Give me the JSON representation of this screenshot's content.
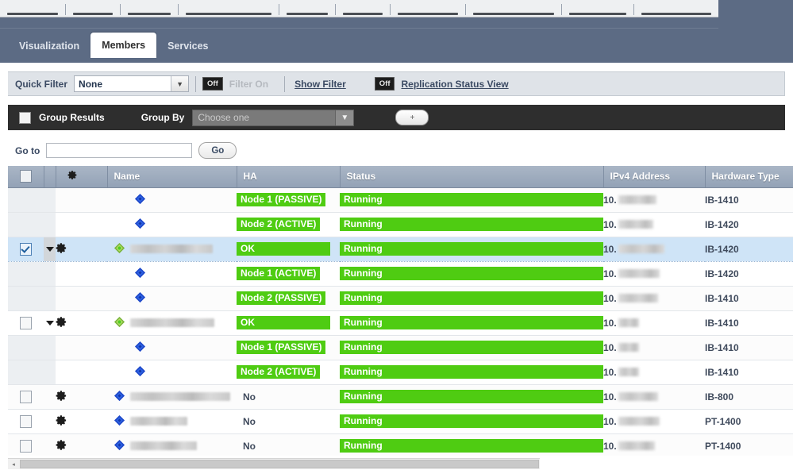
{
  "menu_strip": {
    "item_count": 11,
    "note": "cut-off menu bar"
  },
  "tabs": [
    {
      "label": "Visualization",
      "active": false
    },
    {
      "label": "Members",
      "active": true
    },
    {
      "label": "Services",
      "active": false
    }
  ],
  "quick_filter": {
    "label": "Quick Filter",
    "selected": "None",
    "placeholder": "None",
    "toggle_badge": "Off",
    "toggle_text": "Filter On",
    "show_filter_link": "Show Filter",
    "replication_badge": "Off",
    "replication_link": "Replication Status View",
    "caret_icon": "chevron-down-icon"
  },
  "group_bar": {
    "group_results_label": "Group Results",
    "group_by_label": "Group By",
    "group_by_selected": "Choose one",
    "add_button_label": "+",
    "caret_icon": "chevron-down-icon"
  },
  "goto_bar": {
    "label": "Go to",
    "input_value": "",
    "input_placeholder": "",
    "go_button": "Go"
  },
  "table": {
    "columns": [
      {
        "key": "chk",
        "label": ""
      },
      {
        "key": "exp",
        "label": ""
      },
      {
        "key": "gear",
        "label": "",
        "icon": "gear-icon"
      },
      {
        "key": "name",
        "label": "Name"
      },
      {
        "key": "ha",
        "label": "HA"
      },
      {
        "key": "status",
        "label": "Status"
      },
      {
        "key": "ip",
        "label": "IPv4 Address"
      },
      {
        "key": "hw",
        "label": "Hardware Type"
      }
    ],
    "rows": [
      {
        "kind": "child",
        "checkbox": "none",
        "expand": false,
        "gear": false,
        "name": "",
        "name_redacted": false,
        "name_width": 0,
        "ha": "Node 1 (PASSIVE)",
        "ha_style": "badge",
        "status": "Running",
        "ip_prefix": "10.",
        "ip_width": 48,
        "hw": "IB-1410",
        "selected": false
      },
      {
        "kind": "child",
        "checkbox": "none",
        "expand": false,
        "gear": false,
        "name": "",
        "name_redacted": false,
        "name_width": 0,
        "ha": "Node 2 (ACTIVE)",
        "ha_style": "badge",
        "status": "Running",
        "ip_prefix": "10.",
        "ip_width": 44,
        "hw": "IB-1420",
        "selected": false
      },
      {
        "kind": "parent",
        "checkbox": "checked",
        "expand": true,
        "gear": true,
        "name": "",
        "name_redacted": true,
        "name_width": 104,
        "ha": "OK",
        "ha_style": "badge",
        "status": "Running",
        "ip_prefix": "10.",
        "ip_width": 58,
        "hw": "IB-1420",
        "selected": true
      },
      {
        "kind": "child",
        "checkbox": "none",
        "expand": false,
        "gear": false,
        "name": "",
        "name_redacted": false,
        "name_width": 0,
        "ha": "Node 1 (ACTIVE)",
        "ha_style": "badge",
        "status": "Running",
        "ip_prefix": "10.",
        "ip_width": 52,
        "hw": "IB-1420",
        "selected": false
      },
      {
        "kind": "child",
        "checkbox": "none",
        "expand": false,
        "gear": false,
        "name": "",
        "name_redacted": false,
        "name_width": 0,
        "ha": "Node 2 (PASSIVE)",
        "ha_style": "badge",
        "status": "Running",
        "ip_prefix": "10.",
        "ip_width": 50,
        "hw": "IB-1410",
        "selected": false
      },
      {
        "kind": "parent",
        "checkbox": "unchecked",
        "expand": true,
        "gear": true,
        "name": "",
        "name_redacted": true,
        "name_width": 106,
        "ha": "OK",
        "ha_style": "badge",
        "status": "Running",
        "ip_prefix": "10.",
        "ip_width": 26,
        "hw": "IB-1410",
        "selected": false
      },
      {
        "kind": "child",
        "checkbox": "none",
        "expand": false,
        "gear": false,
        "name": "",
        "name_redacted": false,
        "name_width": 0,
        "ha": "Node 1 (PASSIVE)",
        "ha_style": "badge",
        "status": "Running",
        "ip_prefix": "10.",
        "ip_width": 26,
        "hw": "IB-1410",
        "selected": false
      },
      {
        "kind": "child",
        "checkbox": "none",
        "expand": false,
        "gear": false,
        "name": "",
        "name_redacted": false,
        "name_width": 0,
        "ha": "Node 2 (ACTIVE)",
        "ha_style": "badge",
        "status": "Running",
        "ip_prefix": "10.",
        "ip_width": 26,
        "hw": "IB-1410",
        "selected": false
      },
      {
        "kind": "leaf",
        "checkbox": "unchecked",
        "expand": false,
        "gear": true,
        "name": "",
        "name_redacted": true,
        "name_width": 126,
        "ha": "No",
        "ha_style": "plain",
        "status": "Running",
        "ip_prefix": "10.",
        "ip_width": 50,
        "hw": "IB-800",
        "selected": false
      },
      {
        "kind": "leaf",
        "checkbox": "unchecked",
        "expand": false,
        "gear": true,
        "name": "",
        "name_redacted": true,
        "name_width": 72,
        "ha": "No",
        "ha_style": "plain",
        "status": "Running",
        "ip_prefix": "10.",
        "ip_width": 52,
        "hw": "PT-1400",
        "selected": false
      },
      {
        "kind": "leaf",
        "checkbox": "unchecked",
        "expand": false,
        "gear": true,
        "name": "",
        "name_redacted": true,
        "name_width": 84,
        "ha": "No",
        "ha_style": "plain",
        "status": "Running",
        "ip_prefix": "10.",
        "ip_width": 46,
        "hw": "PT-1400",
        "selected": false
      }
    ]
  },
  "colors": {
    "accent_green": "#4fcc12",
    "header_blue": "#93a2b6",
    "tab_band": "#5c6b84",
    "selected_row": "#cfe4f7",
    "group_bar": "#2e2e2e"
  },
  "scrollbar": {
    "left_arrow": "◂",
    "right_arrow": "▸"
  }
}
